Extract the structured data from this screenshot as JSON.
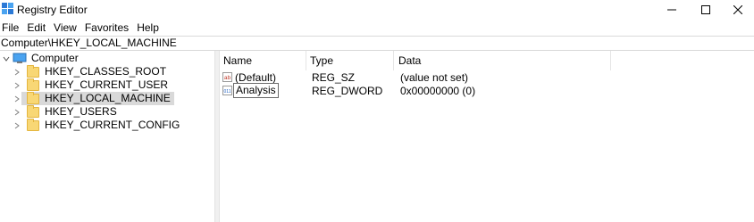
{
  "window": {
    "title": "Registry Editor",
    "minimize_glyph": "—",
    "maximize_glyph": "☐",
    "close_glyph": "✕"
  },
  "menu": [
    "File",
    "Edit",
    "View",
    "Favorites",
    "Help"
  ],
  "address": "Computer\\HKEY_LOCAL_MACHINE",
  "tree": {
    "root": "Computer",
    "items": [
      "HKEY_CLASSES_ROOT",
      "HKEY_CURRENT_USER",
      "HKEY_LOCAL_MACHINE",
      "HKEY_USERS",
      "HKEY_CURRENT_CONFIG"
    ],
    "selected": "HKEY_LOCAL_MACHINE"
  },
  "list": {
    "columns": [
      "Name",
      "Type",
      "Data"
    ],
    "rows": [
      {
        "icon": "string-value-icon",
        "name": "(Default)",
        "type": "REG_SZ",
        "data": "(value not set)"
      },
      {
        "icon": "dword-value-icon",
        "name": "Analysis",
        "type": "REG_DWORD",
        "data": "0x00000000 (0)"
      }
    ]
  },
  "icons": {
    "string_value_label": "ab",
    "dword_value_label": "011"
  },
  "colors": {
    "folder": "#f8d775",
    "selection": "#d9d9d9",
    "string_icon": "#c0392b",
    "dword_icon": "#1f5fbf"
  }
}
